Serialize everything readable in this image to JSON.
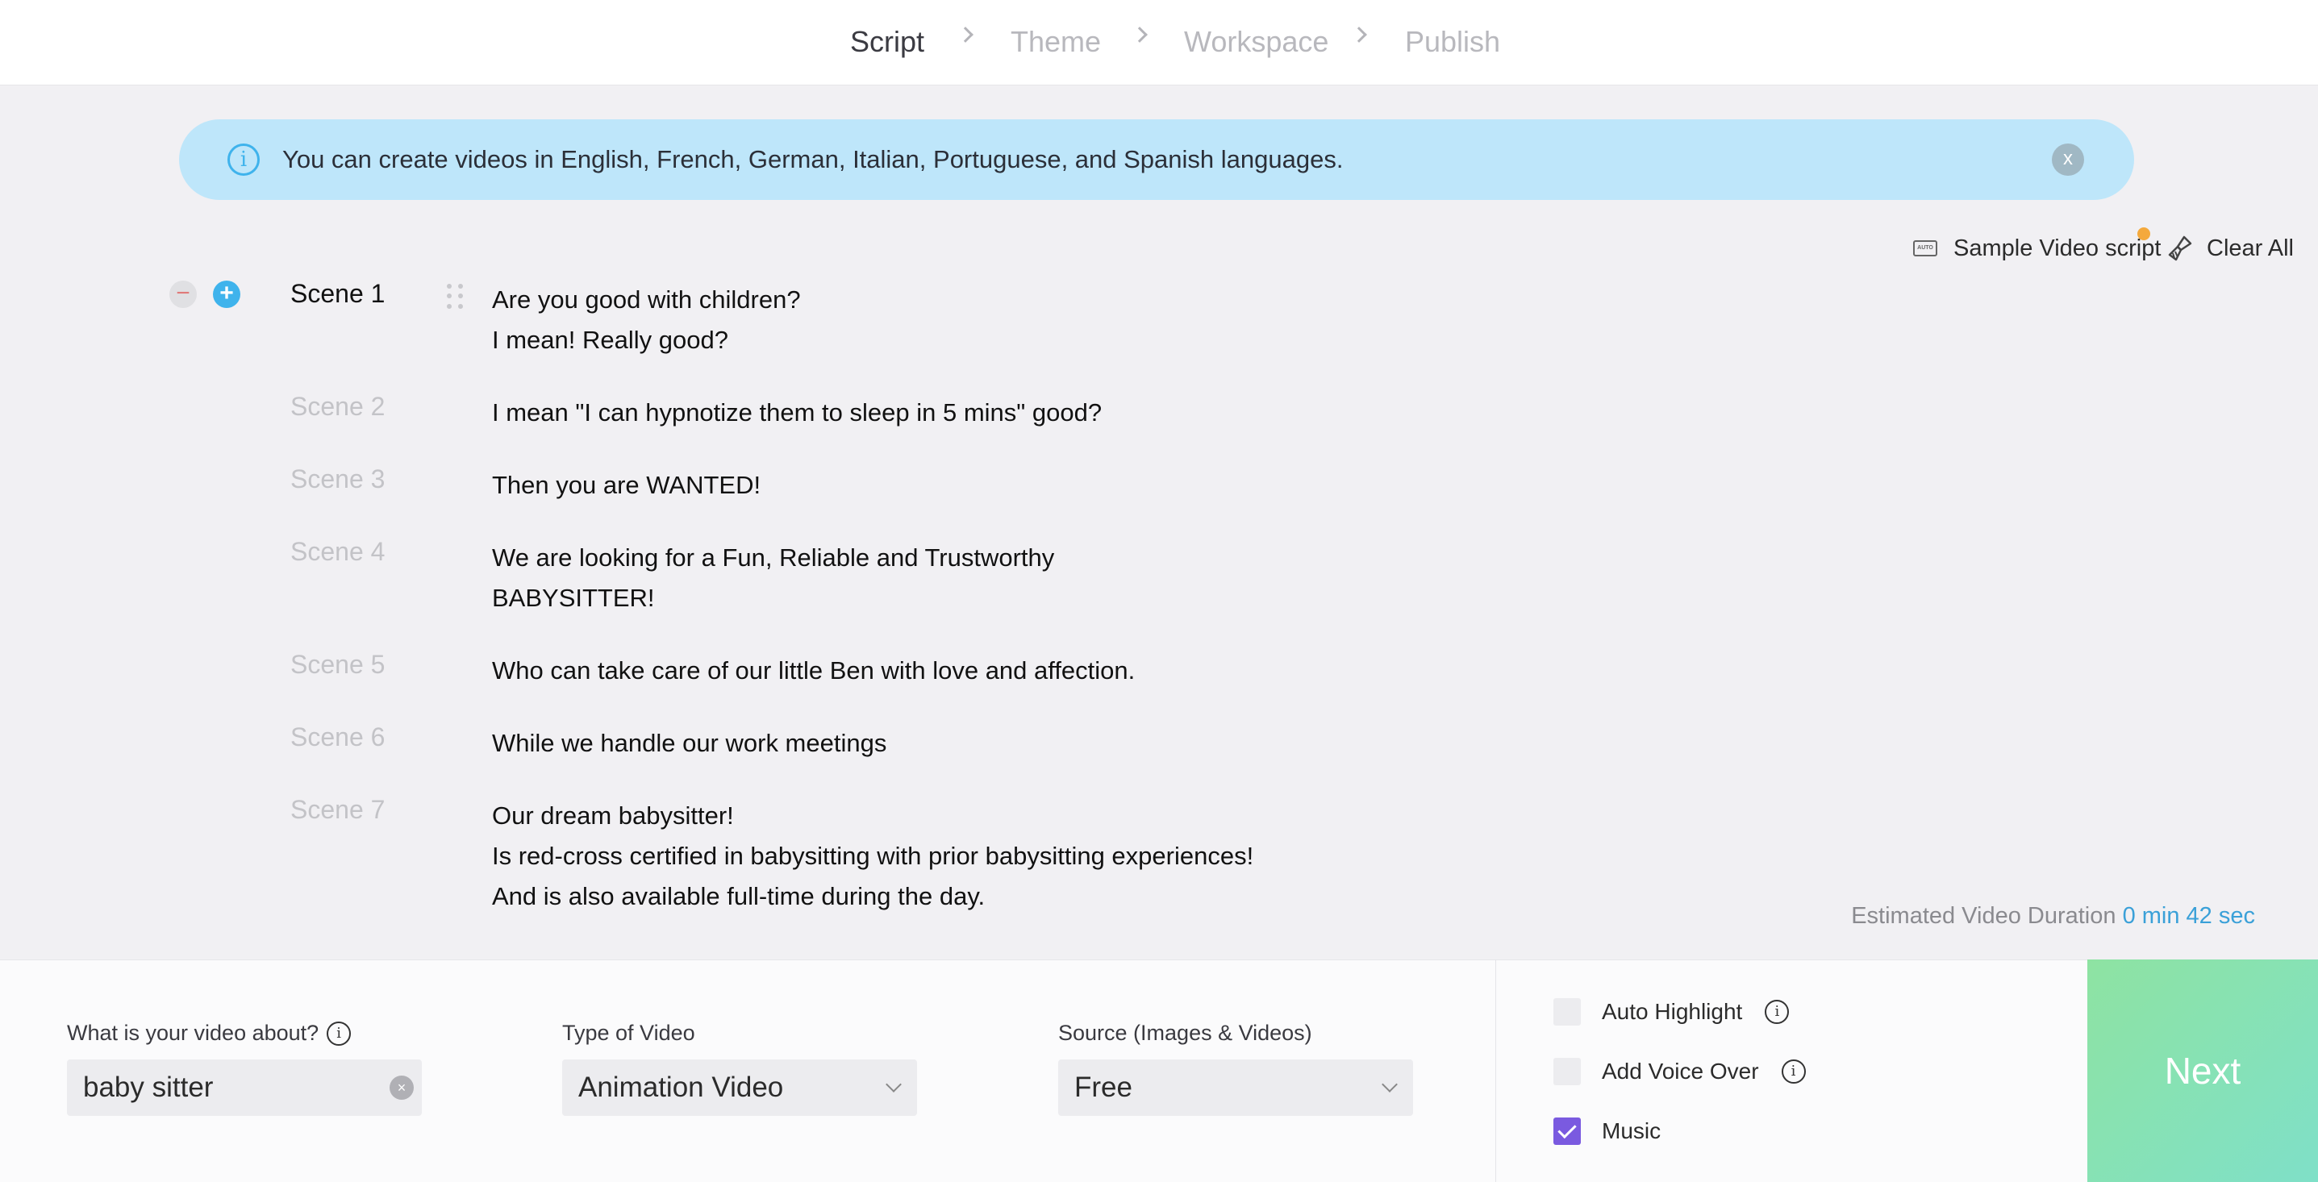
{
  "steps": [
    {
      "label": "Script",
      "active": true
    },
    {
      "label": "Theme",
      "active": false
    },
    {
      "label": "Workspace",
      "active": false
    },
    {
      "label": "Publish",
      "active": false
    }
  ],
  "banner": {
    "message": "You can create videos in English, French, German, Italian, Portuguese, and Spanish languages.",
    "close_label": "x"
  },
  "tools": {
    "sample_label": "Sample Video script",
    "auto_badge": "AUTO",
    "clear_label": "Clear All"
  },
  "scenes": [
    {
      "label": "Scene 1",
      "text": "Are you good with children?\nI mean! Really good?"
    },
    {
      "label": "Scene 2",
      "text": "I mean \"I can hypnotize them to sleep in 5 mins\" good?"
    },
    {
      "label": "Scene 3",
      "text": "Then you are WANTED!"
    },
    {
      "label": "Scene 4",
      "text": "We are looking for a Fun, Reliable and Trustworthy\nBABYSITTER!"
    },
    {
      "label": "Scene 5",
      "text": "Who can take care of our little Ben with love and affection."
    },
    {
      "label": "Scene 6",
      "text": "While we handle our work meetings"
    },
    {
      "label": "Scene 7",
      "text": "Our dream babysitter!\nIs red-cross certified in babysitting with prior babysitting experiences!\nAnd is also available full-time during the day."
    }
  ],
  "estimate": {
    "label": "Estimated Video Duration",
    "value": "0 min 42 sec"
  },
  "form": {
    "about_label": "What is your video about?",
    "about_value": "baby sitter",
    "type_label": "Type of Video",
    "type_value": "Animation Video",
    "source_label": "Source (Images & Videos)",
    "source_value": "Free"
  },
  "options": [
    {
      "label": "Auto Highlight",
      "checked": false
    },
    {
      "label": "Add Voice Over",
      "checked": false
    },
    {
      "label": "Music",
      "checked": true
    }
  ],
  "next_label": "Next",
  "colors": {
    "accent": "#3fb3ec",
    "banner_bg": "#bee6fa",
    "checkbox_on": "#7a5ae0",
    "next_gradient_start": "#8ee3a2",
    "next_gradient_end": "#7fe0c8"
  }
}
